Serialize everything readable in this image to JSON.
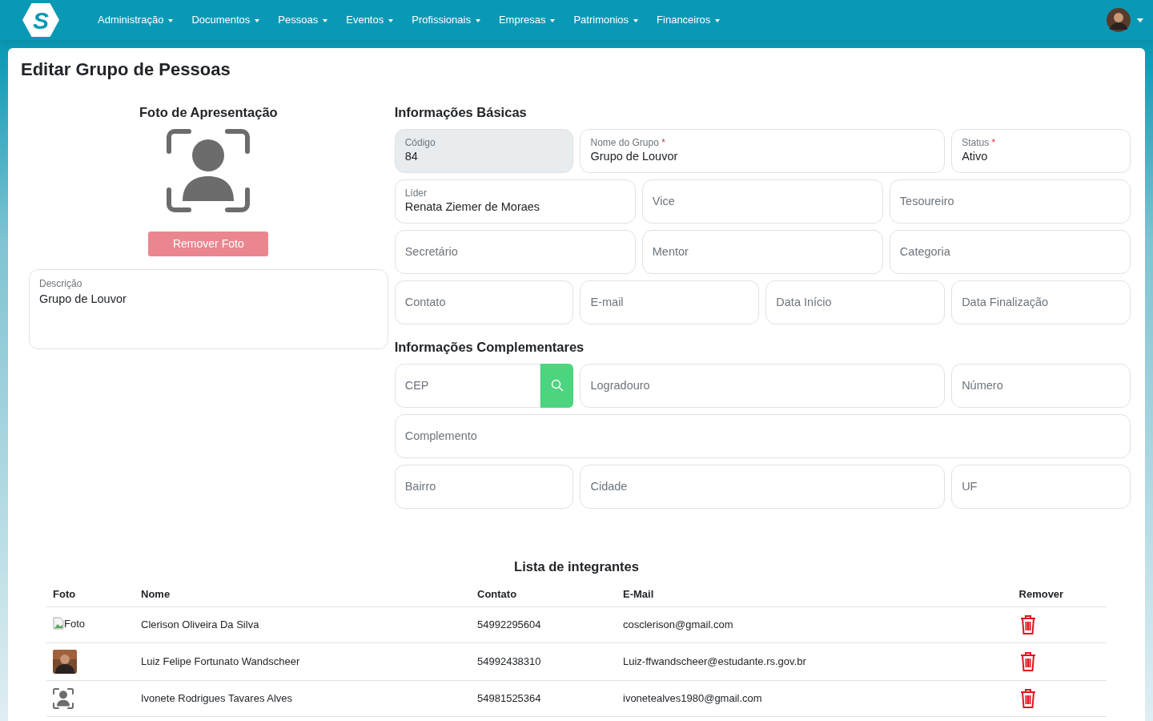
{
  "navbar": {
    "logo_mark": "S",
    "menus": [
      {
        "label": "Administração"
      },
      {
        "label": "Documentos"
      },
      {
        "label": "Pessoas"
      },
      {
        "label": "Eventos"
      },
      {
        "label": "Profissionais"
      },
      {
        "label": "Empresas"
      },
      {
        "label": "Patrimonios"
      },
      {
        "label": "Financeiros"
      }
    ]
  },
  "page_title": "Editar Grupo de Pessoas",
  "photo_section": {
    "title": "Foto de Apresentação",
    "remove_button": "Remover Foto"
  },
  "description": {
    "label": "Descrição",
    "value": "Grupo de Louvor"
  },
  "basic_info": {
    "title": "Informações Básicas",
    "lines": [
      {
        "fields": [
          {
            "label": "Código",
            "value": "84",
            "disabled": true
          },
          {
            "label": "Nome do Grupo",
            "required_mark": "*",
            "value": "Grupo de Louvor",
            "disabled": false
          },
          {
            "label": "Status",
            "required_mark": "*",
            "value": "Ativo",
            "disabled": false
          }
        ]
      },
      {
        "fields": [
          {
            "label": "Líder",
            "value": "Renata Ziemer de Moraes",
            "disabled": false
          },
          {
            "label": "Vice",
            "disabled": false
          },
          {
            "label": "Tesoureiro",
            "disabled": false
          }
        ]
      },
      {
        "fields": [
          {
            "label": "Secretário",
            "disabled": false
          },
          {
            "label": "Mentor",
            "disabled": false
          },
          {
            "label": "Categoria",
            "disabled": false
          }
        ]
      },
      {
        "fields": [
          {
            "label": "Contato",
            "disabled": false
          },
          {
            "label": "E-mail",
            "disabled": false
          },
          {
            "label": "Data Início",
            "disabled": false
          },
          {
            "label": "Data Finalização",
            "disabled": false
          }
        ]
      }
    ]
  },
  "complementary_info": {
    "title": "Informações Complementares",
    "lines": [
      {
        "fields": [
          {
            "label": "CEP",
            "kind": "search",
            "disabled": false
          },
          {
            "label": "Logradouro",
            "kind": "text",
            "disabled": false
          },
          {
            "label": "Número",
            "kind": "text",
            "disabled": false
          }
        ]
      },
      {
        "fields": [
          {
            "label": "Complemento",
            "kind": "text",
            "disabled": false
          }
        ]
      },
      {
        "fields": [
          {
            "label": "Bairro",
            "kind": "text",
            "disabled": false
          },
          {
            "label": "Cidade",
            "kind": "text",
            "disabled": false
          },
          {
            "label": "UF",
            "kind": "text",
            "disabled": false
          }
        ]
      }
    ]
  },
  "members": {
    "title": "Lista de integrantes",
    "columns": [
      "Foto",
      "Nome",
      "Contato",
      "E-Mail",
      "Remover"
    ],
    "rows": [
      {
        "photo": {
          "kind": "broken",
          "alt": "Foto"
        },
        "name": "Clerison Oliveira Da Silva",
        "contact": "54992295604",
        "email": "cosclerison@gmail.com"
      },
      {
        "name": "Luiz Felipe Fortunato Wandscheer",
        "contact": "54992438310",
        "email": "Luiz-ffwandscheer@estudante.rs.gov.br"
      },
      {
        "photo": {
          "kind": "placeholder"
        },
        "name": "Ivonete Rodrigues Tavares Alves",
        "contact": "54981525364",
        "email": "ivonetealves1980@gmail.com"
      }
    ]
  }
}
